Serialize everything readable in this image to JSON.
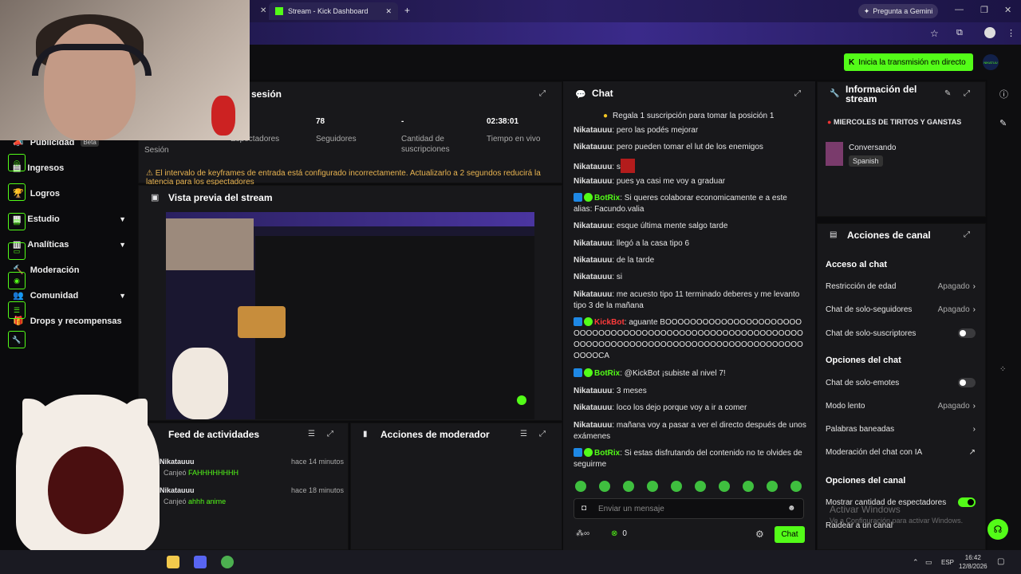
{
  "browser": {
    "tab_title": "Stream - Kick Dashboard",
    "gemini_label": "Pregunta a Gemini"
  },
  "header": {
    "go_live_label": "Inicia la transmisión en directo",
    "logo_text": "NIKATUU"
  },
  "sidebar": {
    "items": [
      {
        "label": "Publicidad",
        "badge": "Beta"
      },
      {
        "label": "Ingresos"
      },
      {
        "label": "Logros"
      },
      {
        "label": "Estudio",
        "expandable": true
      },
      {
        "label": "Analíticas",
        "expandable": true
      },
      {
        "label": "Moderación"
      },
      {
        "label": "Comunidad",
        "expandable": true
      },
      {
        "label": "Drops y recompensas"
      }
    ]
  },
  "session": {
    "title": "sesión",
    "session_label": "Sesión",
    "viewers_label": "Espectadores",
    "followers_value": "78",
    "followers_label": "Seguidores",
    "subs_value": "-",
    "subs_label": "Cantidad de suscripciones",
    "uptime_value": "02:38:01",
    "uptime_label": "Tiempo en vivo",
    "warning": "El intervalo de keyframes de entrada está configurado incorrectamente. Actualizarlo a 2 segundos reducirá la latencia para los espectadores"
  },
  "preview": {
    "title": "Vista previa del stream"
  },
  "activity_feed": {
    "title": "Feed de actividades",
    "items": [
      {
        "user": "Nikatauuu",
        "action": "Canjeó",
        "reward": "FAHHHHHHHH",
        "time": "hace 14 minutos"
      },
      {
        "user": "Nikatauuu",
        "action": "Canjeó",
        "reward": "ahhh anime",
        "time": "hace 18 minutos"
      }
    ]
  },
  "mod_actions": {
    "title": "Acciones de moderador"
  },
  "chat": {
    "title": "Chat",
    "pinned": "Regala 1 suscripción para tomar la posición 1",
    "messages": [
      {
        "user": "Nikatauuu",
        "text": "pero las podés mejorar"
      },
      {
        "user": "Nikatauuu",
        "text": "pero pueden tomar el lut de los enemigos"
      },
      {
        "user": "Nikatauuu",
        "text": "s"
      },
      {
        "user": "Nikatauuu",
        "text": "pues ya casi me voy a graduar"
      },
      {
        "user": "BotRix",
        "text": "Si queres colaborar economicamente e a este alias: Facundo.valia"
      },
      {
        "user": "Nikatauuu",
        "text": "esque última mente salgo tarde"
      },
      {
        "user": "Nikatauuu",
        "text": "llegó a la casa tipo 6"
      },
      {
        "user": "Nikatauuu",
        "text": "de la tarde"
      },
      {
        "user": "Nikatauuu",
        "text": "si"
      },
      {
        "user": "Nikatauuu",
        "text": "me acuesto tipo 11 terminado deberes y me levanto tipo 3 de la mañana"
      },
      {
        "user": "KickBot",
        "text": "aguante BOOOOOOOOOOOOOOOOOOOOOOOOOOOOOOOOOOOOOOOOOOOOOOOOOOOOOOOOOOOOOOOOOOOOOOOOOOOOOOOOOOOOOOOOOOOOOOOOOOOOCA"
      },
      {
        "user": "BotRix",
        "text": "@KickBot ¡subiste al nivel 7!"
      },
      {
        "user": "Nikatauuu",
        "text": "3 meses"
      },
      {
        "user": "Nikatauuu",
        "text": "loco los dejo porque voy a ir a comer"
      },
      {
        "user": "Nikatauuu",
        "text": "mañana voy a pasar a ver el directo después de unos exámenes"
      },
      {
        "user": "BotRix",
        "text": "Si estas disfrutando del contenido no te olvides de seguirme"
      }
    ],
    "input_placeholder": "Enviar un mensaje",
    "points": "0",
    "send_label": "Chat"
  },
  "stream_info": {
    "title": "Información del stream",
    "stream_title": "MIERCOLES DE TIRITOS Y GANSTAS",
    "category": "Conversando",
    "language": "Spanish"
  },
  "channel_actions": {
    "title": "Acciones de canal",
    "chat_access_heading": "Acceso al chat",
    "age_restriction": "Restricción de edad",
    "age_value": "Apagado",
    "followers_only": "Chat de solo-seguidores",
    "followers_value": "Apagado",
    "subs_only": "Chat de solo-suscriptores",
    "chat_options_heading": "Opciones del chat",
    "emotes_only": "Chat de solo-emotes",
    "slow_mode": "Modo lento",
    "slow_value": "Apagado",
    "banned_words": "Palabras baneadas",
    "ai_mod": "Moderación del chat con IA",
    "channel_options_heading": "Opciones del canal",
    "show_viewers": "Mostrar cantidad de espectadores",
    "raid": "Raidear a un canal"
  },
  "windows": {
    "activate_title": "Activar Windows",
    "activate_sub": "Ve a Configuración para activar Windows.",
    "lang": "ESP",
    "time": "16:42",
    "date": "12/8/2026"
  }
}
